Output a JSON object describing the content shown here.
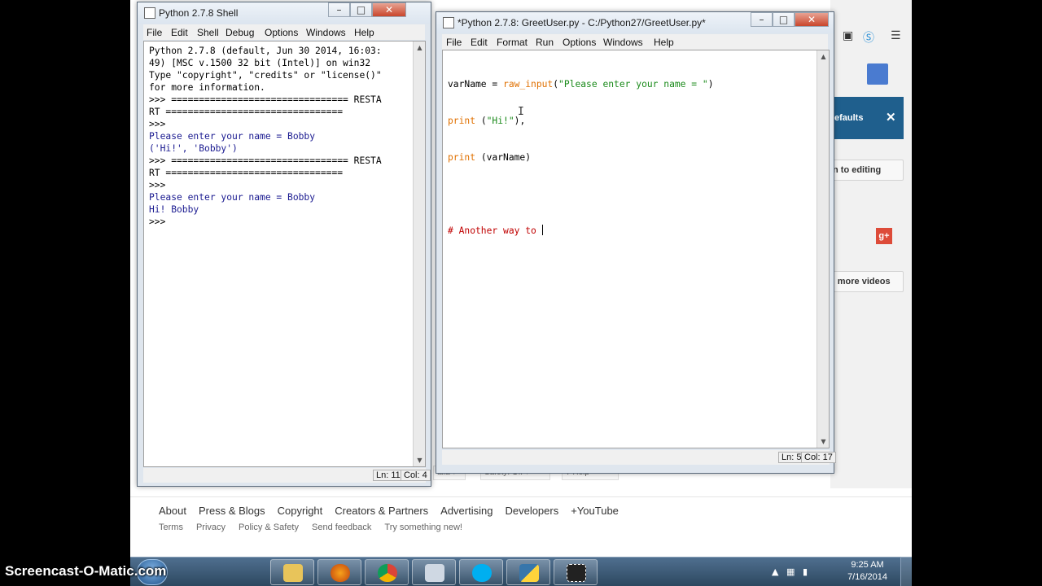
{
  "shell": {
    "title": "Python 2.7.8 Shell",
    "menu": [
      "File",
      "Edit",
      "Shell",
      "Debug",
      "Options",
      "Windows",
      "Help"
    ],
    "lines": [
      {
        "text": "Python 2.7.8 (default, Jun 30 2014, 16:03:",
        "cls": ""
      },
      {
        "text": "49) [MSC v.1500 32 bit (Intel)] on win32",
        "cls": ""
      },
      {
        "text": "Type \"copyright\", \"credits\" or \"license()\"",
        "cls": ""
      },
      {
        "text": "for more information.",
        "cls": ""
      },
      {
        "text": ">>> ================================ RESTA",
        "cls": ""
      },
      {
        "text": "RT ================================",
        "cls": ""
      },
      {
        "text": ">>>",
        "cls": ""
      },
      {
        "text": "Please enter your name = Bobby",
        "cls": "c-blue"
      },
      {
        "text": "('Hi!', 'Bobby')",
        "cls": "c-blue"
      },
      {
        "text": ">>> ================================ RESTA",
        "cls": ""
      },
      {
        "text": "RT ================================",
        "cls": ""
      },
      {
        "text": ">>>",
        "cls": ""
      },
      {
        "text": "Please enter your name = Bobby",
        "cls": "c-blue"
      },
      {
        "text": "Hi! Bobby",
        "cls": "c-blue"
      },
      {
        "text": ">>>",
        "cls": ""
      }
    ],
    "status_ln": "Ln: 11",
    "status_col": "Col: 4"
  },
  "editor": {
    "title": "*Python 2.7.8: GreetUser.py - C:/Python27/GreetUser.py*",
    "menu": [
      "File",
      "Edit",
      "Format",
      "Run",
      "Options",
      "Windows",
      "Help"
    ],
    "code": {
      "l1_a": "varName = ",
      "l1_b": "raw_input",
      "l1_c": "(",
      "l1_d": "\"Please enter your name = \"",
      "l1_e": ")",
      "l2_a": "print",
      "l2_b": " (",
      "l2_c": "\"Hi!\"",
      "l2_d": "),",
      "l3_a": "print",
      "l3_b": " (varName)",
      "l5": "# Another way to "
    },
    "status_ln": "Ln: 5",
    "status_col": "Col: 17"
  },
  "browser": {
    "banner_text": "efaults",
    "banner_close": "✕",
    "btn_editing": "n to editing",
    "btn_more": "d more videos",
    "gplus": "g+",
    "lang_label": "alia",
    "safety_label": "Safety: Off",
    "help_label": "Help",
    "footer_links": [
      "About",
      "Press & Blogs",
      "Copyright",
      "Creators & Partners",
      "Advertising",
      "Developers",
      "+YouTube"
    ],
    "footer_small": [
      "Terms",
      "Privacy",
      "Policy & Safety",
      "Send feedback",
      "Try something new!"
    ]
  },
  "taskbar": {
    "watermark": "Screencast-O-Matic.com",
    "time": "9:25 AM",
    "date": "7/16/2014"
  },
  "colors": {
    "keyword": "#e07000",
    "string": "#1a8a1a",
    "comment": "#c00000",
    "output": "#1a1a90",
    "yt_banner": "#1f5f8d"
  }
}
